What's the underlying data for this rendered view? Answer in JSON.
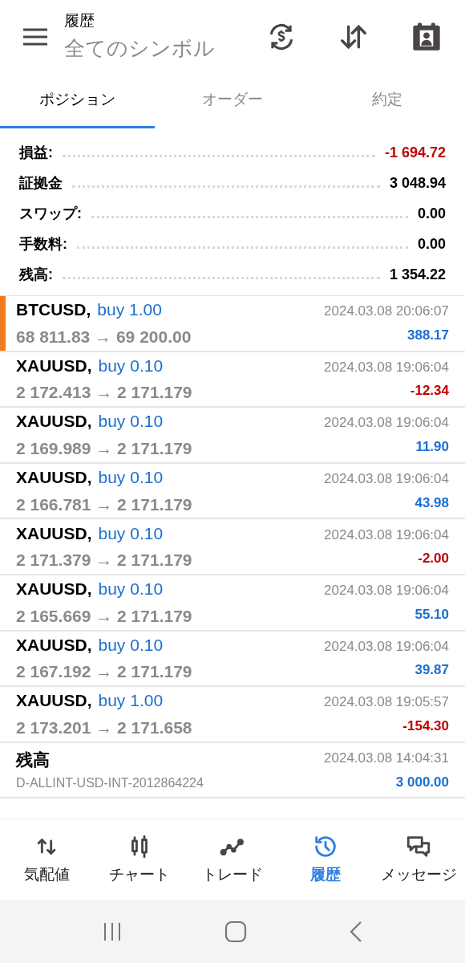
{
  "header": {
    "title": "履歴",
    "subtitle": "全てのシンボル"
  },
  "tabs": [
    {
      "label": "ポジション",
      "selected": true
    },
    {
      "label": "オーダー",
      "selected": false
    },
    {
      "label": "約定",
      "selected": false
    }
  ],
  "summary": [
    {
      "label": "損益:",
      "value": "-1 694.72",
      "kind": "loss"
    },
    {
      "label": "証拠金",
      "value": "3 048.94",
      "kind": "plain"
    },
    {
      "label": "スワップ:",
      "value": "0.00",
      "kind": "plain"
    },
    {
      "label": "手数料:",
      "value": "0.00",
      "kind": "plain"
    },
    {
      "label": "残高:",
      "value": "1 354.22",
      "kind": "plain"
    }
  ],
  "deals": [
    {
      "kind": "trade",
      "symbol": "BTCUSD,",
      "action": "buy 1.00",
      "prices": "68 811.83 → 69 200.00",
      "time": "2024.03.08 20:06:07",
      "result": "388.17",
      "color": "#1a6fd1",
      "selected": true
    },
    {
      "kind": "trade",
      "symbol": "XAUUSD,",
      "action": "buy 0.10",
      "prices": "2 172.413 → 2 171.179",
      "time": "2024.03.08 19:06:04",
      "result": "-12.34",
      "color": "#c00000",
      "selected": false
    },
    {
      "kind": "trade",
      "symbol": "XAUUSD,",
      "action": "buy 0.10",
      "prices": "2 169.989 → 2 171.179",
      "time": "2024.03.08 19:06:04",
      "result": "11.90",
      "color": "#1a6fd1",
      "selected": false
    },
    {
      "kind": "trade",
      "symbol": "XAUUSD,",
      "action": "buy 0.10",
      "prices": "2 166.781 → 2 171.179",
      "time": "2024.03.08 19:06:04",
      "result": "43.98",
      "color": "#1a6fd1",
      "selected": false
    },
    {
      "kind": "trade",
      "symbol": "XAUUSD,",
      "action": "buy 0.10",
      "prices": "2 171.379 → 2 171.179",
      "time": "2024.03.08 19:06:04",
      "result": "-2.00",
      "color": "#c00000",
      "selected": false
    },
    {
      "kind": "trade",
      "symbol": "XAUUSD,",
      "action": "buy 0.10",
      "prices": "2 165.669 → 2 171.179",
      "time": "2024.03.08 19:06:04",
      "result": "55.10",
      "color": "#1a6fd1",
      "selected": false
    },
    {
      "kind": "trade",
      "symbol": "XAUUSD,",
      "action": "buy 0.10",
      "prices": "2 167.192 → 2 171.179",
      "time": "2024.03.08 19:06:04",
      "result": "39.87",
      "color": "#1a6fd1",
      "selected": false
    },
    {
      "kind": "trade",
      "symbol": "XAUUSD,",
      "action": "buy 1.00",
      "prices": "2 173.201 → 2 171.658",
      "time": "2024.03.08 19:05:57",
      "result": "-154.30",
      "color": "#c00000",
      "selected": false
    },
    {
      "kind": "balance",
      "symbol": "残高",
      "prices": "D-ALLINT-USD-INT-2012864224",
      "time": "2024.03.08 14:04:31",
      "result": "3 000.00",
      "color": "#1a6fd1",
      "selected": false
    }
  ],
  "nav": [
    {
      "label": "気配値",
      "selected": false
    },
    {
      "label": "チャート",
      "selected": false
    },
    {
      "label": "トレード",
      "selected": false
    },
    {
      "label": "履歴",
      "selected": true
    },
    {
      "label": "メッセージ",
      "selected": false
    }
  ]
}
